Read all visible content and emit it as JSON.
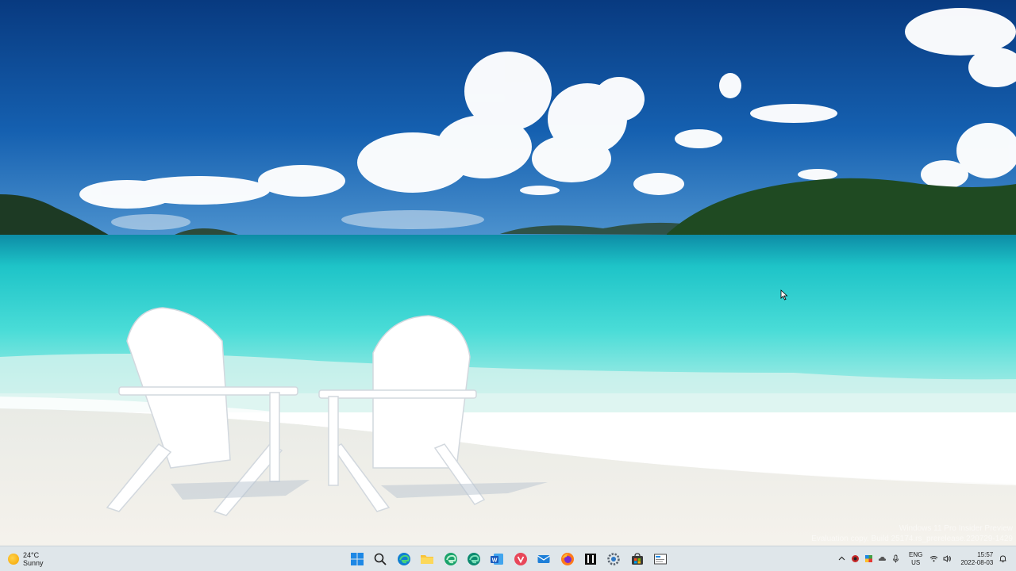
{
  "desktop": {
    "watermark": {
      "line1": "Windows 11 Pro Insider Preview",
      "line2": "Evaluation copy. Build 25174.rs_prerelease.220729-1429"
    }
  },
  "taskbar": {
    "weather": {
      "temperature": "24°C",
      "condition": "Sunny",
      "icon": "sun-icon"
    },
    "apps": [
      {
        "name": "start-button",
        "icon": "windows-logo-icon"
      },
      {
        "name": "search-button",
        "icon": "search-icon"
      },
      {
        "name": "edge-button",
        "icon": "edge-icon"
      },
      {
        "name": "file-explorer-button",
        "icon": "folder-icon"
      },
      {
        "name": "edge-beta-button",
        "icon": "edge-beta-icon"
      },
      {
        "name": "edge-dev-button",
        "icon": "edge-dev-icon"
      },
      {
        "name": "word-button",
        "icon": "word-icon"
      },
      {
        "name": "vivaldi-button",
        "icon": "vivaldi-icon"
      },
      {
        "name": "mail-button",
        "icon": "mail-icon"
      },
      {
        "name": "firefox-button",
        "icon": "firefox-icon"
      },
      {
        "name": "notion-button",
        "icon": "notion-icon"
      },
      {
        "name": "settings-button",
        "icon": "gear-icon"
      },
      {
        "name": "store-button",
        "icon": "store-icon"
      },
      {
        "name": "snipping-tool-button",
        "icon": "screenshot-icon"
      }
    ],
    "tray": {
      "language_line1": "ENG",
      "language_line2": "US",
      "time": "15:57",
      "date": "2022-08-03"
    }
  },
  "colors": {
    "taskbar_bg": "#dfe6ea",
    "sky": "#0d4b94",
    "sea": "#2fd4d0",
    "sand": "#f3f1ec"
  }
}
